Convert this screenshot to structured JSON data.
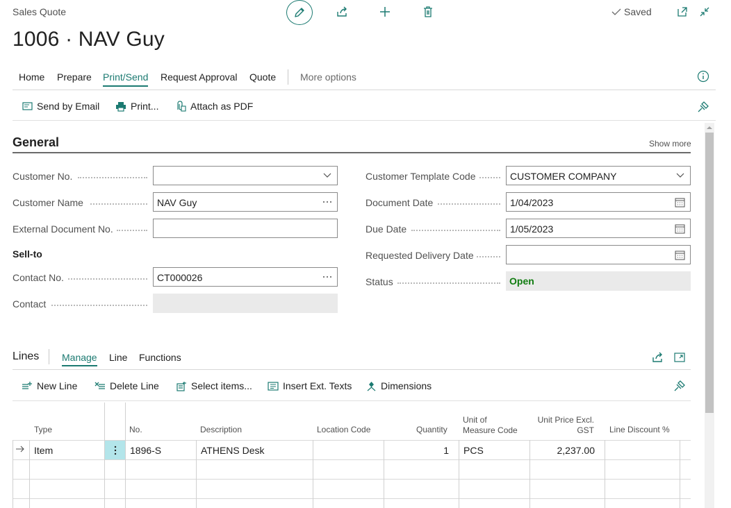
{
  "header": {
    "page_type": "Sales Quote",
    "title": "1006 · NAV Guy",
    "saved_label": "Saved"
  },
  "menu": {
    "items": [
      "Home",
      "Prepare",
      "Print/Send",
      "Request Approval",
      "Quote"
    ],
    "active": "Print/Send",
    "more": "More options"
  },
  "actions": {
    "send_by_email": "Send by Email",
    "print": "Print...",
    "attach_as_pdf": "Attach as PDF"
  },
  "general": {
    "title": "General",
    "show_more": "Show more",
    "sell_to_heading": "Sell-to",
    "fields": {
      "customer_no": {
        "label": "Customer No.",
        "value": ""
      },
      "customer_name": {
        "label": "Customer Name",
        "value": "NAV Guy"
      },
      "external_document_no": {
        "label": "External Document No.",
        "value": ""
      },
      "contact_no": {
        "label": "Contact No.",
        "value": "CT000026"
      },
      "contact": {
        "label": "Contact",
        "value": ""
      },
      "customer_template_code": {
        "label": "Customer Template Code",
        "value": "CUSTOMER COMPANY"
      },
      "document_date": {
        "label": "Document Date",
        "value": "1/04/2023"
      },
      "due_date": {
        "label": "Due Date",
        "value": "1/05/2023"
      },
      "requested_delivery_date": {
        "label": "Requested Delivery Date",
        "value": ""
      },
      "status": {
        "label": "Status",
        "value": "Open"
      }
    }
  },
  "lines": {
    "title": "Lines",
    "tabs": [
      "Manage",
      "Line",
      "Functions"
    ],
    "active_tab": "Manage",
    "actions": {
      "new_line": "New Line",
      "delete_line": "Delete Line",
      "select_items": "Select items...",
      "insert_ext_texts": "Insert Ext. Texts",
      "dimensions": "Dimensions"
    },
    "columns": {
      "type": "Type",
      "no": "No.",
      "description": "Description",
      "location_code": "Location Code",
      "quantity": "Quantity",
      "uom_line1": "Unit of",
      "uom_line2": "Measure Code",
      "price_line1": "Unit Price Excl.",
      "price_line2": "GST",
      "line_discount": "Line Discount %"
    },
    "rows": [
      {
        "type": "Item",
        "no": "1896-S",
        "description": "ATHENS Desk",
        "location_code": "",
        "quantity": "1",
        "uom": "PCS",
        "unit_price": "2,237.00",
        "line_discount": ""
      }
    ]
  },
  "colors": {
    "accent": "#1b7a71",
    "status_open": "#107c10"
  }
}
